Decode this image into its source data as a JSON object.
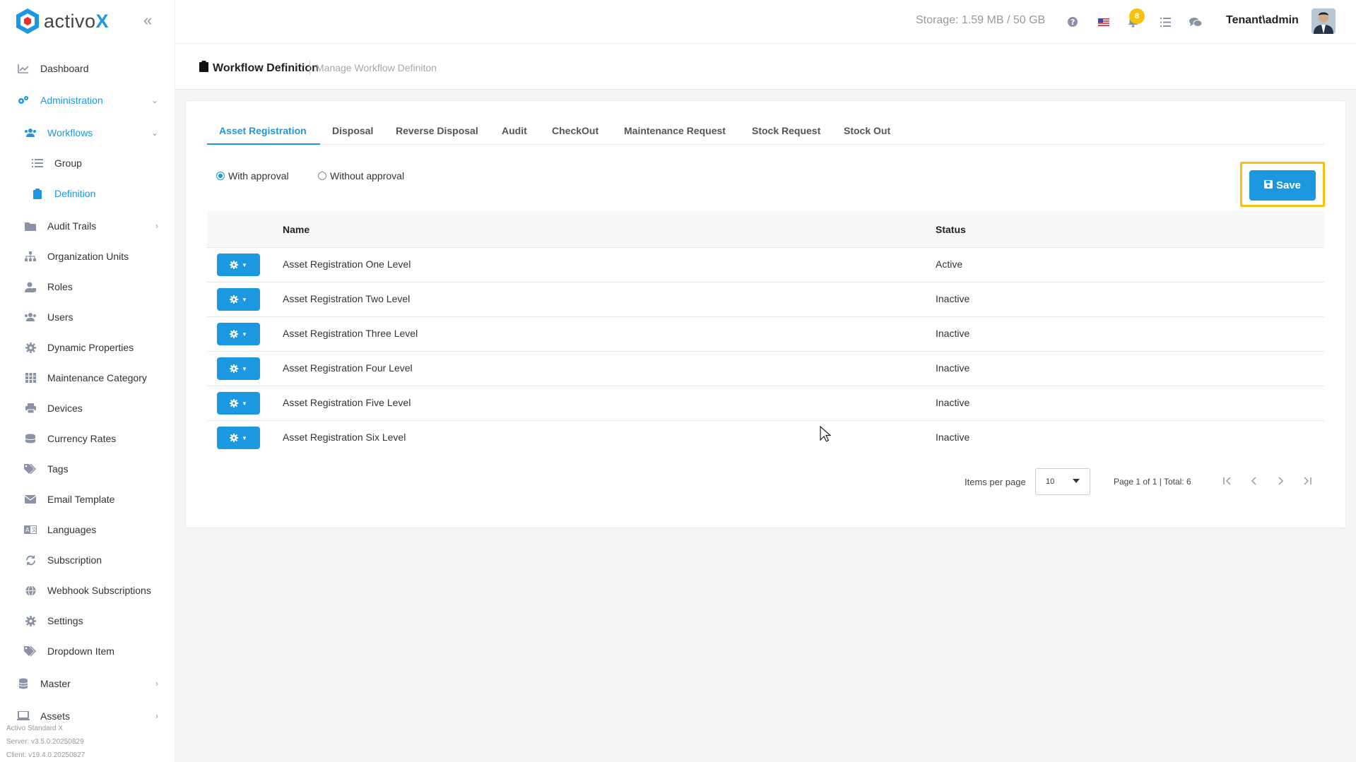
{
  "brand": {
    "name_prefix": "activo",
    "name_suffix": "X"
  },
  "sidebar": {
    "items": [
      {
        "label": "Dashboard",
        "icon": "chart-line-icon"
      },
      {
        "label": "Administration",
        "icon": "cogs-icon"
      },
      {
        "label": "Workflows",
        "icon": "users-icon"
      },
      {
        "label": "Group",
        "icon": "list-icon"
      },
      {
        "label": "Definition",
        "icon": "clipboard-icon"
      },
      {
        "label": "Audit Trails",
        "icon": "folder-icon"
      },
      {
        "label": "Organization Units",
        "icon": "sitemap-icon"
      },
      {
        "label": "Roles",
        "icon": "user-tie-icon"
      },
      {
        "label": "Users",
        "icon": "users-icon"
      },
      {
        "label": "Dynamic Properties",
        "icon": "gear-icon"
      },
      {
        "label": "Maintenance Category",
        "icon": "grid-icon"
      },
      {
        "label": "Devices",
        "icon": "print-icon"
      },
      {
        "label": "Currency Rates",
        "icon": "coins-icon"
      },
      {
        "label": "Tags",
        "icon": "tags-icon"
      },
      {
        "label": "Email Template",
        "icon": "envelope-icon"
      },
      {
        "label": "Languages",
        "icon": "language-icon"
      },
      {
        "label": "Subscription",
        "icon": "sync-icon"
      },
      {
        "label": "Webhook Subscriptions",
        "icon": "globe-icon"
      },
      {
        "label": "Settings",
        "icon": "gear-icon"
      },
      {
        "label": "Dropdown Item",
        "icon": "tags-icon"
      },
      {
        "label": "Master",
        "icon": "database-icon"
      },
      {
        "label": "Assets",
        "icon": "laptop-icon"
      }
    ],
    "footer": {
      "product": "Activo Standard X",
      "server": "Server: v3.5.0.20250829",
      "client": "Client: v19.4.0.20250827"
    }
  },
  "header": {
    "storage": "Storage: 1.59 MB / 50 GB",
    "notification_count": "8",
    "user": "Tenant\\admin"
  },
  "page": {
    "title": "Workflow Definition",
    "subtitle": "Manage Workflow Definiton"
  },
  "tabs": [
    "Asset Registration",
    "Disposal",
    "Reverse Disposal",
    "Audit",
    "CheckOut",
    "Maintenance Request",
    "Stock Request",
    "Stock Out"
  ],
  "approval": {
    "with": "With approval",
    "without": "Without approval",
    "selected": "with"
  },
  "save_label": "Save",
  "table": {
    "headers": {
      "name": "Name",
      "status": "Status"
    },
    "rows": [
      {
        "name": "Asset Registration One Level",
        "status": "Active"
      },
      {
        "name": "Asset Registration Two Level",
        "status": "Inactive"
      },
      {
        "name": "Asset Registration Three Level",
        "status": "Inactive"
      },
      {
        "name": "Asset Registration Four Level",
        "status": "Inactive"
      },
      {
        "name": "Asset Registration Five Level",
        "status": "Inactive"
      },
      {
        "name": "Asset Registration Six Level",
        "status": "Inactive"
      }
    ]
  },
  "pager": {
    "items_per_page_label": "Items per page",
    "items_per_page": "10",
    "info": "Page 1 of 1 | Total: 6"
  },
  "colors": {
    "accent": "#1b98e0",
    "highlight": "#f6c20d"
  }
}
